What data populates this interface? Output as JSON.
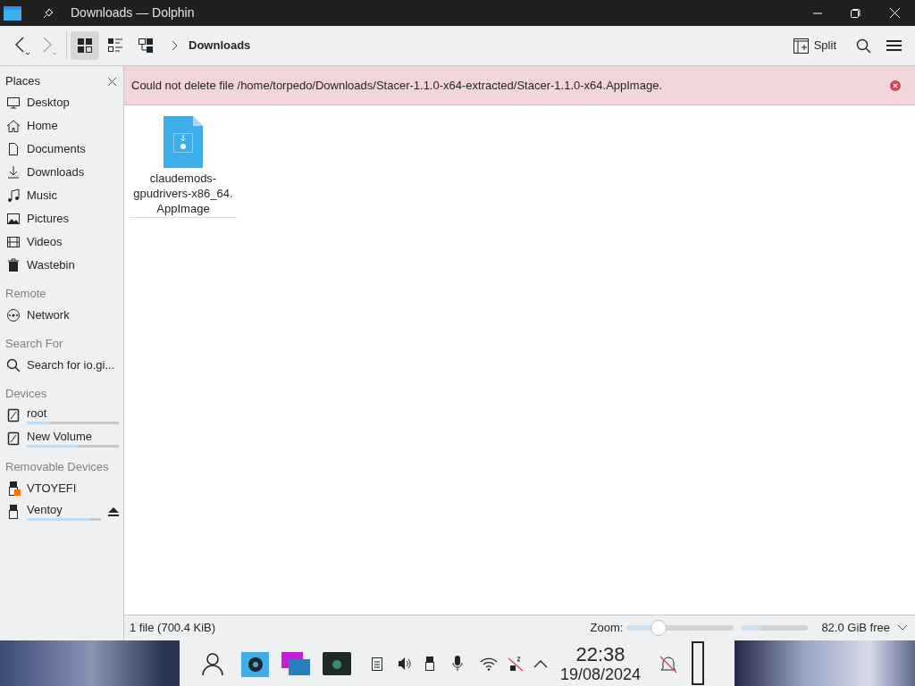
{
  "window": {
    "title": "Downloads — Dolphin"
  },
  "toolbar": {
    "view_modes": [
      {
        "kind": "icons",
        "selected": true
      },
      {
        "kind": "details",
        "selected": false
      },
      {
        "kind": "tree",
        "selected": false
      }
    ],
    "breadcrumb": "Downloads",
    "split": "Split"
  },
  "sidebar": {
    "sections": [
      {
        "heading": "Places",
        "items": [
          {
            "label": "Desktop"
          },
          {
            "label": "Home"
          },
          {
            "label": "Documents"
          },
          {
            "label": "Downloads"
          },
          {
            "label": "Music"
          },
          {
            "label": "Pictures"
          },
          {
            "label": "Videos"
          },
          {
            "label": "Wastebin"
          }
        ]
      },
      {
        "heading": "Remote",
        "items": [
          {
            "label": "Network"
          }
        ]
      },
      {
        "heading": "Search For",
        "items": [
          {
            "label": "Search for io.gi..."
          }
        ]
      },
      {
        "heading": "Devices",
        "items": [
          {
            "label": "root",
            "level": 0.25
          },
          {
            "label": "New Volume",
            "level": 0.55
          }
        ]
      },
      {
        "heading": "Removable Devices",
        "items": [
          {
            "label": "VTOYEFI"
          },
          {
            "label": "Ventoy",
            "level": 0.85,
            "eject": true
          }
        ]
      }
    ]
  },
  "error": "Could not delete file /home/torpedo/Downloads/Stacer-1.1.0-x64-extracted/Stacer-1.1.0-x64.AppImage.",
  "files": [
    {
      "name": "claudemods-\ngpudrivers-x86_64.\nAppImage"
    }
  ],
  "status_bar": {
    "summary": "1 file (700.4 KiB)",
    "zoom": {
      "label": "Zoom:",
      "level": 0.3
    },
    "free_space": {
      "level": 0.3,
      "text": "82.0 GiB free"
    }
  },
  "taskbar": {
    "time": "22:38",
    "date": "19/08/2024"
  }
}
